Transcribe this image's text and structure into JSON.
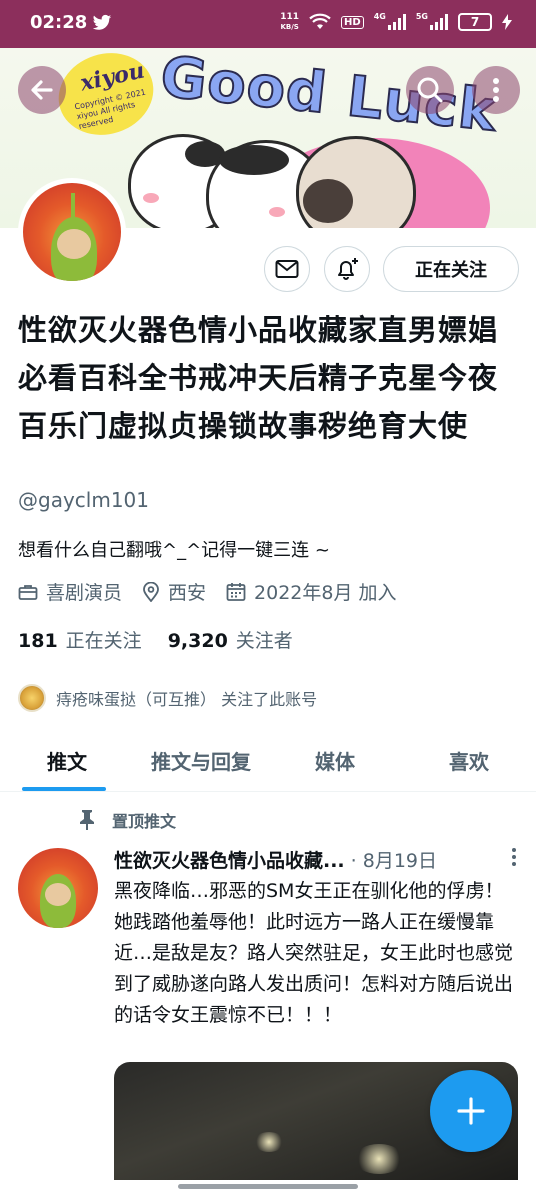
{
  "status_bar": {
    "time": "02:28",
    "net_speed_value": "111",
    "net_speed_unit": "KB/S",
    "hd_label": "HD",
    "signal_1": "4G",
    "signal_2": "5G",
    "battery": "7"
  },
  "banner": {
    "logo_text": "xiyou",
    "logo_small": "Copyright © 2021 xiyou All rights reserved",
    "headline": "Good Luck"
  },
  "actions": {
    "follow_label": "正在关注"
  },
  "profile": {
    "display_name": "性欲灭火器色情小品收藏家直男嫖娼必看百科全书戒冲天后精子克星今夜百乐门虚拟贞操锁故事秽绝育大使",
    "handle": "@gayclm101",
    "bio": "想看什么自己翻哦^_^记得一键三连 ~",
    "category": "喜剧演员",
    "location": "西安",
    "joined": "2022年8月 加入",
    "following_count": "181",
    "following_label": "正在关注",
    "followers_count": "9,320",
    "followers_label": "关注者",
    "followed_by": "痔疮味蛋挞（可互推） 关注了此账号"
  },
  "tabs": [
    {
      "label": "推文",
      "active": true
    },
    {
      "label": "推文与回复",
      "active": false
    },
    {
      "label": "媒体",
      "active": false
    },
    {
      "label": "喜欢",
      "active": false
    }
  ],
  "pinned_tweet": {
    "pinned_label": "置顶推文",
    "author": "性欲灭火器色情小品收藏...",
    "date": "· 8月19日",
    "text": "黑夜降临…邪恶的SM女王正在驯化他的俘虏！她践踏他羞辱他！此时远方一路人正在缓慢靠近…是敌是友？路人突然驻足，女王此时也感觉到了威胁遂向路人发出质问！怎料对方随后说出的话令女王震惊不已！！！"
  },
  "colors": {
    "status_bar": "#8c2f5c",
    "accent": "#1d9bf0",
    "secondary_text": "#536471"
  },
  "icons": [
    "twitter-bird-icon",
    "wifi-icon",
    "battery-icon",
    "back-arrow-icon",
    "search-icon",
    "more-vertical-icon",
    "mail-icon",
    "bell-plus-icon",
    "briefcase-icon",
    "location-pin-icon",
    "calendar-icon",
    "pin-icon",
    "more-vertical-small-icon",
    "plus-icon"
  ]
}
